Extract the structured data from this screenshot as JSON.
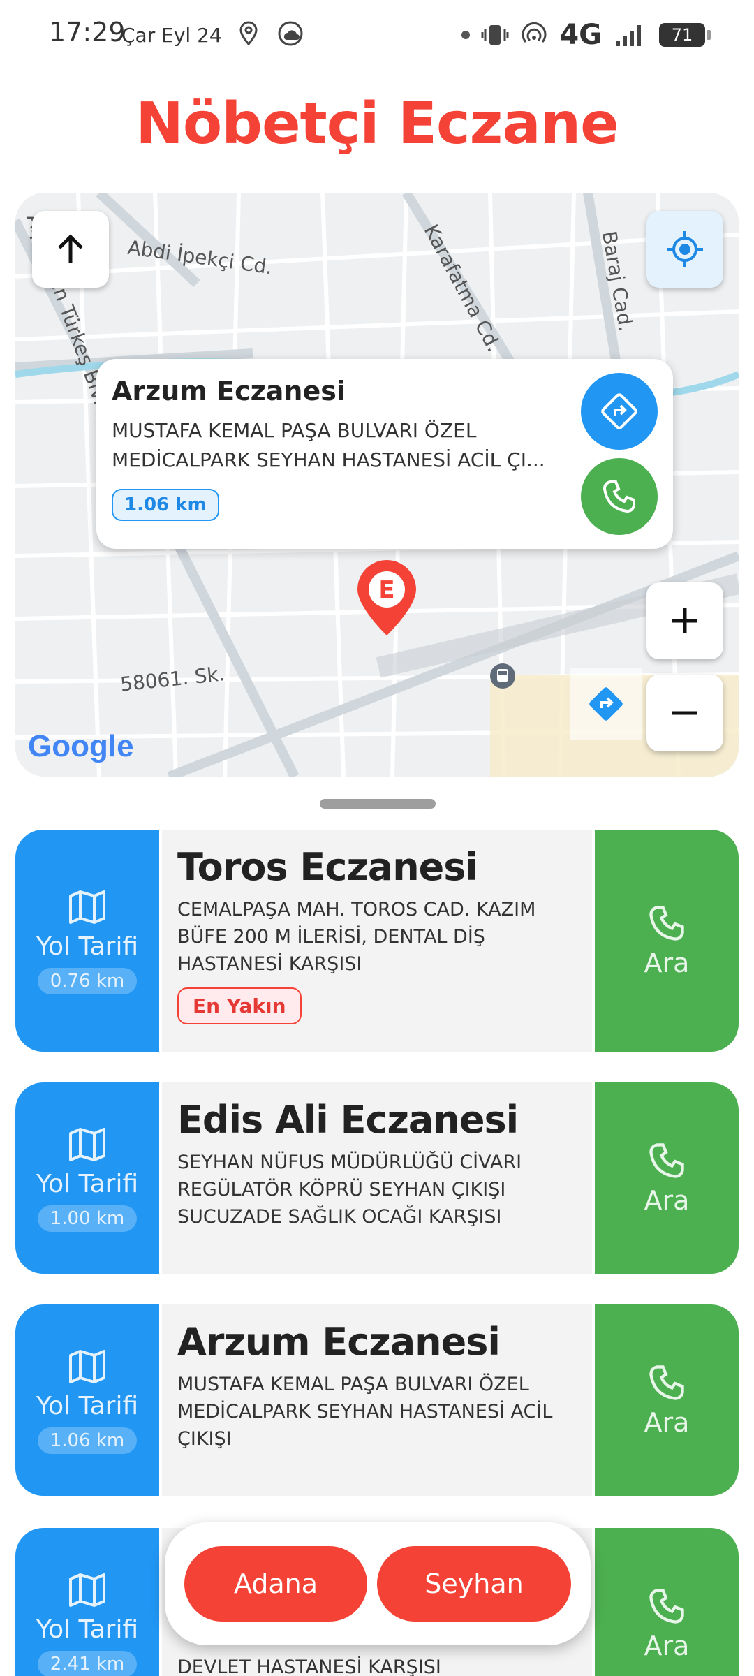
{
  "status_bar": {
    "time": "17:29",
    "date": "Çar Eyl 24",
    "network": "4G",
    "battery": "71"
  },
  "app": {
    "title": "Nöbetçi Eczane",
    "colors": {
      "title": "#f44336",
      "blue": "#2196f3",
      "green": "#4caf50"
    }
  },
  "map": {
    "street_labels": [
      "Abdi İpekçi Cd.",
      "Karafatma Cd.",
      "Baraj Cad.",
      "Alparslan Türkeş Blv.",
      "58061. Sk."
    ],
    "google": "Google",
    "pin_letter": "E",
    "popup": {
      "name": "Arzum Eczanesi",
      "address_line1": "MUSTAFA KEMAL PAŞA BULVARI ÖZEL",
      "address_line2": "MEDİCALPARK SEYHAN HASTANESİ ACİL ÇI...",
      "distance": "1.06 km"
    },
    "icons": [
      "arrow-up-icon",
      "my-location-icon",
      "directions-icon",
      "phone-icon",
      "zoom-in-icon",
      "zoom-out-icon"
    ]
  },
  "pharmacies": [
    {
      "name": "Toros Eczanesi",
      "address": "CEMALPAŞA MAH. TOROS CAD. KAZIM BÜFE 200 M İLERİSİ, DENTAL DİŞ HASTANESİ KARŞISI",
      "distance": "0.76 km",
      "badge": "En Yakın"
    },
    {
      "name": "Edis Ali Eczanesi",
      "address": "SEYHAN NÜFUS MÜDÜRLÜĞÜ CİVARI REGÜLATÖR KÖPRÜ SEYHAN ÇIKIŞI SUCUZADE SAĞLIK OCAĞI KARŞISI",
      "distance": "1.00 km"
    },
    {
      "name": "Arzum Eczanesi",
      "address": "MUSTAFA KEMAL PAŞA BULVARI ÖZEL MEDİCALPARK SEYHAN HASTANESİ ACİL ÇIKIŞI",
      "distance": "1.06 km"
    },
    {
      "name": "",
      "address": "DEVLET HASTANESİ KARŞISI",
      "distance": "2.41 km"
    }
  ],
  "card_labels": {
    "directions": "Yol Tarifi",
    "call": "Ara"
  },
  "bottom_bar": {
    "city": "Adana",
    "district": "Seyhan"
  }
}
